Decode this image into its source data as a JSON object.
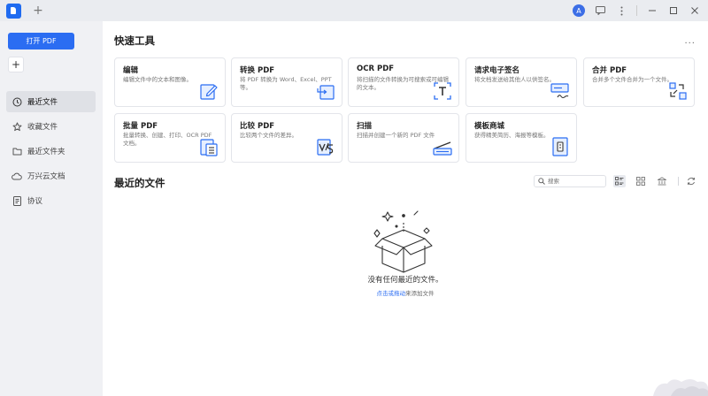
{
  "titlebar": {
    "new_tab": "+",
    "avatar_letter": "A"
  },
  "sidebar": {
    "open_pdf": "打开 PDF",
    "add": "+",
    "items": [
      {
        "label": "最近文件",
        "icon": "clock-icon",
        "active": true
      },
      {
        "label": "收藏文件",
        "icon": "star-icon"
      },
      {
        "label": "最近文件夹",
        "icon": "folder-icon"
      },
      {
        "label": "万兴云文档",
        "icon": "cloud-icon"
      },
      {
        "label": "协议",
        "icon": "document-icon"
      }
    ]
  },
  "quick_tools": {
    "title": "快速工具",
    "more": "...",
    "cards": [
      {
        "title": "编辑",
        "desc": "编辑文件中的文本和图像。",
        "icon": "edit-icon"
      },
      {
        "title": "转换 PDF",
        "desc": "将 PDF 转换为 Word、Excel、PPT等。",
        "icon": "convert-icon"
      },
      {
        "title": "OCR PDF",
        "desc": "将扫描的文件转换为可搜索或可编辑的文本。",
        "icon": "ocr-icon"
      },
      {
        "title": "请求电子签名",
        "desc": "将文档发送给其他人以供签名。",
        "icon": "signature-icon"
      },
      {
        "title": "合并 PDF",
        "desc": "合并多个文件合并为一个文件。",
        "icon": "merge-icon"
      },
      {
        "title": "批量 PDF",
        "desc": "批量转换、创建、打印、OCR PDF 文档。",
        "icon": "batch-icon"
      },
      {
        "title": "比较 PDF",
        "desc": "比较两个文件的差异。",
        "icon": "compare-icon"
      },
      {
        "title": "扫描",
        "desc": "扫描并创建一个新的 PDF 文件",
        "icon": "scan-icon"
      },
      {
        "title": "模板商城",
        "desc": "获得精美简历、海报等模板。",
        "icon": "template-icon"
      }
    ]
  },
  "recent": {
    "title": "最近的文件",
    "search_placeholder": "搜索",
    "empty_title": "没有任何最近的文件。",
    "empty_link": "点击或拖动",
    "empty_suffix": "来添加文件"
  }
}
